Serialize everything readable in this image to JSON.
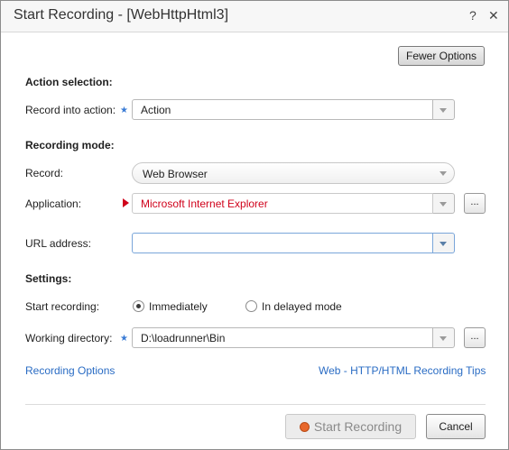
{
  "dialog": {
    "title": "Start Recording - [WebHttpHtml3]",
    "help_glyph": "?",
    "close_glyph": "✕"
  },
  "buttons": {
    "fewer_options": "Fewer Options",
    "start_recording": "Start Recording",
    "cancel": "Cancel",
    "browse": "..."
  },
  "action_selection": {
    "heading": "Action selection:",
    "record_into_label": "Record into action:",
    "record_into_value": "Action"
  },
  "recording_mode": {
    "heading": "Recording mode:",
    "record_label": "Record:",
    "record_value": "Web Browser",
    "application_label": "Application:",
    "application_value": "Microsoft Internet Explorer",
    "url_label": "URL address:",
    "url_value": ""
  },
  "settings": {
    "heading": "Settings:",
    "start_label": "Start recording:",
    "option_immediately": "Immediately",
    "option_delayed": "In delayed mode",
    "selected": "Immediately",
    "working_dir_label": "Working directory:",
    "working_dir_value": "D:\\loadrunner\\Bin"
  },
  "links": {
    "recording_options": "Recording Options",
    "tips": "Web - HTTP/HTML Recording Tips"
  },
  "colors": {
    "accent_link": "#2a6cc4",
    "required_star": "#3a7bd5",
    "error_red": "#d0021b",
    "start_icon": "#e8672a",
    "focused_border": "#7aa6da"
  },
  "icons": {
    "required": "star-icon",
    "dropdown": "chevron-down-icon",
    "start": "record-icon",
    "invalid": "red-arrow-icon"
  }
}
